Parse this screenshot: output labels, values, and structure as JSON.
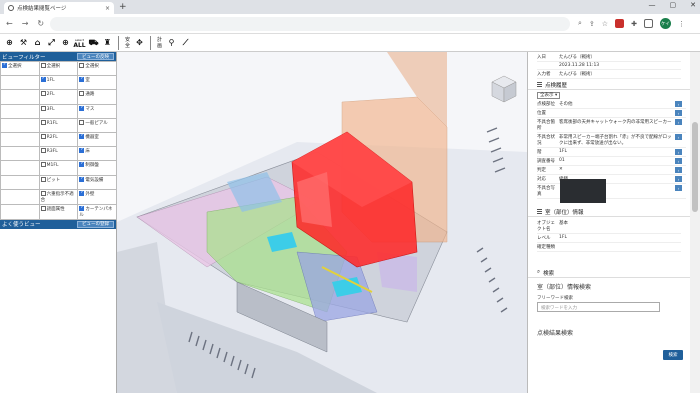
{
  "browser": {
    "tab_title": "点検結果閲覧ページ",
    "tab_close": "×",
    "new_tab": "+",
    "window_controls": [
      "—",
      "▢",
      "✕"
    ],
    "avatar_text": "ケイ"
  },
  "toolbar": {
    "icons": [
      "⊕",
      "⚒",
      "⌂",
      "⤢",
      "⊕",
      "ALL",
      "⛟",
      "♜"
    ],
    "select_all_label": "select",
    "safety_label": "安\n全",
    "plan_label": "計\n画"
  },
  "left_panel": {
    "view_filter_title": "ビューフィルター",
    "view_filter_button": "ビューの反映",
    "filters": [
      [
        {
          "label": "全選択",
          "checked": true
        },
        {
          "label": "全選択",
          "checked": false
        },
        {
          "label": "全選択",
          "checked": false
        }
      ],
      [
        {
          "label": "",
          "checked": false
        },
        {
          "label": "1FL",
          "checked": true
        },
        {
          "label": "室",
          "checked": true
        }
      ],
      [
        {
          "label": "",
          "checked": false
        },
        {
          "label": "2FL",
          "checked": false
        },
        {
          "label": "通路",
          "checked": false
        }
      ],
      [
        {
          "label": "",
          "checked": false
        },
        {
          "label": "3FL",
          "checked": false
        },
        {
          "label": "マス",
          "checked": true
        }
      ],
      [
        {
          "label": "",
          "checked": false
        },
        {
          "label": "R1FL",
          "checked": false
        },
        {
          "label": "一般ピアル",
          "checked": false
        }
      ],
      [
        {
          "label": "",
          "checked": false
        },
        {
          "label": "R2FL",
          "checked": false
        },
        {
          "label": "機器室",
          "checked": true
        }
      ],
      [
        {
          "label": "",
          "checked": false
        },
        {
          "label": "R3FL",
          "checked": false
        },
        {
          "label": "床",
          "checked": true
        }
      ],
      [
        {
          "label": "",
          "checked": false
        },
        {
          "label": "M1FL",
          "checked": false
        },
        {
          "label": "制御盤",
          "checked": true
        }
      ],
      [
        {
          "label": "",
          "checked": false
        },
        {
          "label": "ピット",
          "checked": false
        },
        {
          "label": "電気設備",
          "checked": true
        }
      ],
      [
        {
          "label": "",
          "checked": false
        },
        {
          "label": "六重指示不適合",
          "checked": false
        },
        {
          "label": "外壁",
          "checked": true
        }
      ],
      [
        {
          "label": "",
          "checked": false
        },
        {
          "label": "謎面属性",
          "checked": false
        },
        {
          "label": "カーテンパネル",
          "checked": true
        }
      ]
    ],
    "favorites_title": "よく使うビュー",
    "favorites_button": "ビューの登録"
  },
  "right_panel": {
    "top_rows": [
      {
        "k": "入日",
        "v": "たんびる（戦術）"
      },
      {
        "k": "",
        "v": "2023.11.28 11:13"
      },
      {
        "k": "入力者",
        "v": "たんびる（戦術）"
      }
    ],
    "history_title": "点検履歴",
    "history_filter": "全表示",
    "history_rows": [
      {
        "k": "点検部位",
        "v": "その他"
      },
      {
        "k": "位置",
        "v": ""
      },
      {
        "k": "不具合箇所",
        "v": "客席後部の天井キャットウォーク内の非常用スピーカー"
      },
      {
        "k": "不具合状況",
        "v": "非常用スピーカー端子台割れ「赤」が不良で配線がロックに出来ず、非常放送が出ない。"
      },
      {
        "k": "階",
        "v": "1FL"
      },
      {
        "k": "調査番号",
        "v": "01"
      },
      {
        "k": "判定",
        "v": "✕"
      },
      {
        "k": "対応",
        "v": "修繕"
      },
      {
        "k": "不具合写真",
        "v": ""
      }
    ],
    "room_info_title": "室（部位）情報",
    "room_info_rows": [
      {
        "k": "オブジェクト名",
        "v": "基本"
      },
      {
        "k": "レベル",
        "v": "1FL"
      },
      {
        "k": "確定種類",
        "v": ""
      }
    ],
    "search_section": "検索",
    "room_search_title": "室（部位）情報検索",
    "free_word_label": "フリーワード検索",
    "search_placeholder": "検索ワードを入力",
    "search_button": "検索",
    "result_search_title": "点検結果検索"
  }
}
